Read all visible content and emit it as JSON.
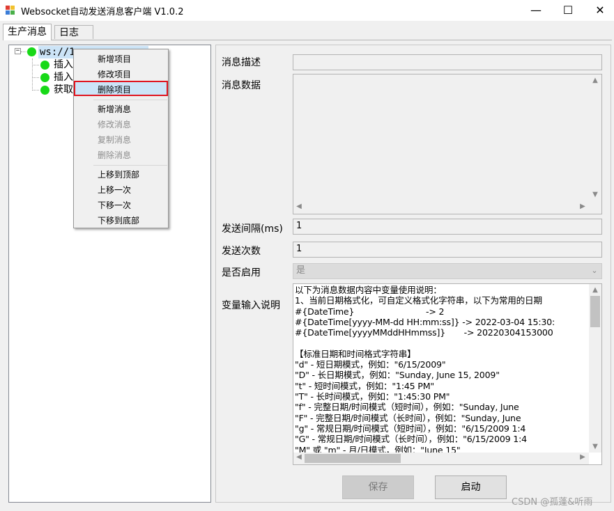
{
  "window": {
    "title": "Websocket自动发送消息客户端 V1.0.2",
    "minimize_glyph": "—",
    "maximize_glyph": "☐",
    "close_glyph": "✕"
  },
  "tabs": [
    {
      "label": "生产消息",
      "active": true
    },
    {
      "label": "日志",
      "active": false
    }
  ],
  "tree": {
    "toggle_glyph": "−",
    "status_color": "#18d918",
    "root": "ws://1",
    "children": [
      "插入",
      "插入",
      "获取"
    ]
  },
  "context_menu": {
    "items": [
      {
        "label": "新增项目",
        "enabled": true
      },
      {
        "label": "修改项目",
        "enabled": true
      },
      {
        "label": "删除项目",
        "enabled": true,
        "highlighted": true
      },
      {
        "label": "新增消息",
        "enabled": true
      },
      {
        "label": "修改消息",
        "enabled": false
      },
      {
        "label": "复制消息",
        "enabled": false
      },
      {
        "label": "删除消息",
        "enabled": false
      },
      {
        "label": "上移到顶部",
        "enabled": true
      },
      {
        "label": "上移一次",
        "enabled": true
      },
      {
        "label": "下移一次",
        "enabled": true
      },
      {
        "label": "下移到底部",
        "enabled": true
      }
    ]
  },
  "form": {
    "desc_label": "消息描述",
    "desc_value": "",
    "data_label": "消息数据",
    "data_value": "",
    "interval_label": "发送间隔(ms)",
    "interval_value": "1",
    "count_label": "发送次数",
    "count_value": "1",
    "enabled_label": "是否启用",
    "enabled_value": "是",
    "var_label": "变量输入说明",
    "var_lines": [
      "以下为消息数据内容中变量使用说明：",
      "1、当前日期格式化，可自定义格式化字符串，以下为常用的日期",
      "#{DateTime}                           -> 2",
      "#{DateTime[yyyy-MM-dd HH:mm:ss]} -> 2022-03-04 15:30:",
      "#{DateTime[yyyyMMddHHmmss]}       -> 20220304153000",
      "",
      "【标准日期和时间格式字符串】",
      "\"d\" - 短日期模式，例如：\"6/15/2009\"",
      "\"D\" - 长日期模式，例如：\"Sunday, June 15, 2009\"",
      "\"t\" - 短时间模式，例如：\"1:45 PM\"",
      "\"T\" - 长时间模式，例如：\"1:45:30 PM\"",
      "\"f\" - 完整日期/时间模式（短时间），例如：\"Sunday, June",
      "\"F\" - 完整日期/时间模式（长时间），例如：\"Sunday, June",
      "\"g\" - 常规日期/时间模式（短时间），例如：\"6/15/2009 1:4",
      "\"G\" - 常规日期/时间模式（长时间），例如：\"6/15/2009 1:4",
      "\"M\" 或 \"m\" - 月/日模式，例如：\"June 15\""
    ]
  },
  "buttons": {
    "save": "保存",
    "start": "启动"
  },
  "watermark": "CSDN @孤蓬&听雨"
}
